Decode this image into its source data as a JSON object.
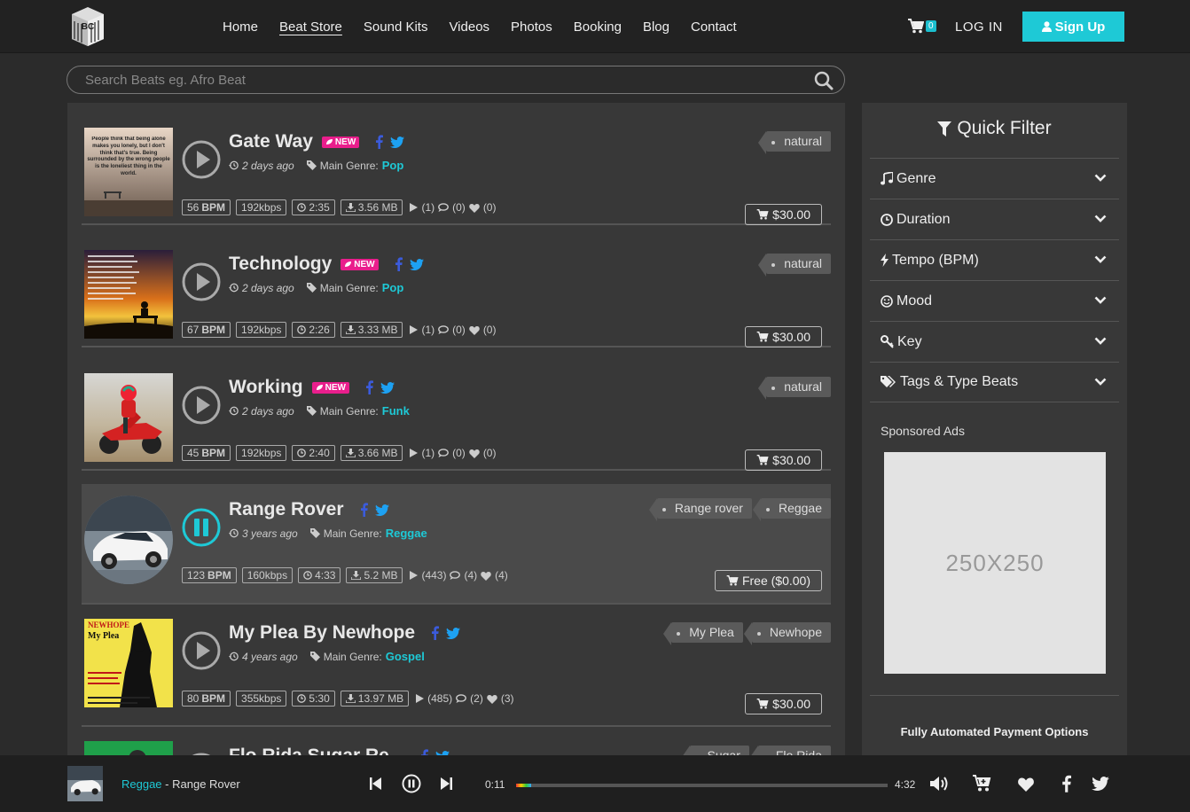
{
  "header": {
    "logo_text": "BC",
    "nav": [
      "Home",
      "Beat Store",
      "Sound Kits",
      "Videos",
      "Photos",
      "Booking",
      "Blog",
      "Contact"
    ],
    "active_nav": "Beat Store",
    "cart_count": "0",
    "login_label": "LOG IN",
    "signup_label": "Sign Up"
  },
  "search": {
    "placeholder": "Search Beats eg. Afro Beat"
  },
  "beats": [
    {
      "title": "Gate Way",
      "new": "NEW",
      "ago": "2 days ago",
      "genre_label": "Main Genre:",
      "genre": "Pop",
      "tags": [
        "natural"
      ],
      "bpm": "56",
      "bpm_unit": "BPM",
      "kbps": "192kbps",
      "duration": "2:35",
      "size": "3.56 MB",
      "plays": "(1)",
      "comments": "(0)",
      "likes": "(0)",
      "price": "$30.00"
    },
    {
      "title": "Technology",
      "new": "NEW",
      "ago": "2 days ago",
      "genre_label": "Main Genre:",
      "genre": "Pop",
      "tags": [
        "natural"
      ],
      "bpm": "67",
      "bpm_unit": "BPM",
      "kbps": "192kbps",
      "duration": "2:26",
      "size": "3.33 MB",
      "plays": "(1)",
      "comments": "(0)",
      "likes": "(0)",
      "price": "$30.00"
    },
    {
      "title": "Working",
      "new": "NEW",
      "ago": "2 days ago",
      "genre_label": "Main Genre:",
      "genre": "Funk",
      "tags": [
        "natural"
      ],
      "bpm": "45",
      "bpm_unit": "BPM",
      "kbps": "192kbps",
      "duration": "2:40",
      "size": "3.66 MB",
      "plays": "(1)",
      "comments": "(0)",
      "likes": "(0)",
      "price": "$30.00"
    },
    {
      "title": "Range Rover",
      "new": "",
      "ago": "3 years ago",
      "genre_label": "Main Genre:",
      "genre": "Reggae",
      "tags": [
        "Range rover",
        "Reggae"
      ],
      "bpm": "123",
      "bpm_unit": "BPM",
      "kbps": "160kbps",
      "duration": "4:33",
      "size": "5.2 MB",
      "plays": "(443)",
      "comments": "(4)",
      "likes": "(4)",
      "price": "Free ($0.00)"
    },
    {
      "title": "My Plea By Newhope",
      "new": "",
      "ago": "4 years ago",
      "genre_label": "Main Genre:",
      "genre": "Gospel",
      "tags": [
        "My Plea",
        "Newhope"
      ],
      "bpm": "80",
      "bpm_unit": "BPM",
      "kbps": "355kbps",
      "duration": "5:30",
      "size": "13.97 MB",
      "plays": "(485)",
      "comments": "(2)",
      "likes": "(3)",
      "price": "$30.00"
    },
    {
      "title": "Flo Rida Sugar Re...",
      "new": "",
      "tags": [
        "Sugar",
        "Flo Rida"
      ]
    }
  ],
  "thumb_text": {
    "quote1": "People think that being alone makes you lonely, but I don't think that's true. Being surrounded by the wrong people is the loneliest thing in the world.",
    "newhope_brand": "NEWHOPE",
    "newhope_title": "My Plea"
  },
  "sidebar": {
    "title": "Quick Filter",
    "filters": [
      "Genre",
      "Duration",
      "Tempo (BPM)",
      "Mood",
      "Key",
      "Tags & Type Beats"
    ],
    "ads_title": "Sponsored Ads",
    "ad_text": "250X250",
    "payment": "Fully Automated Payment Options"
  },
  "player": {
    "genre": "Reggae",
    "separator": " - ",
    "title": "Range Rover",
    "current": "0:11",
    "total": "4:32",
    "progress_fraction": 0.04
  },
  "colors": {
    "accent": "#1ec9d6",
    "new_badge": "#e91e8c",
    "facebook": "#3b5bdb",
    "twitter": "#1da1f2"
  }
}
